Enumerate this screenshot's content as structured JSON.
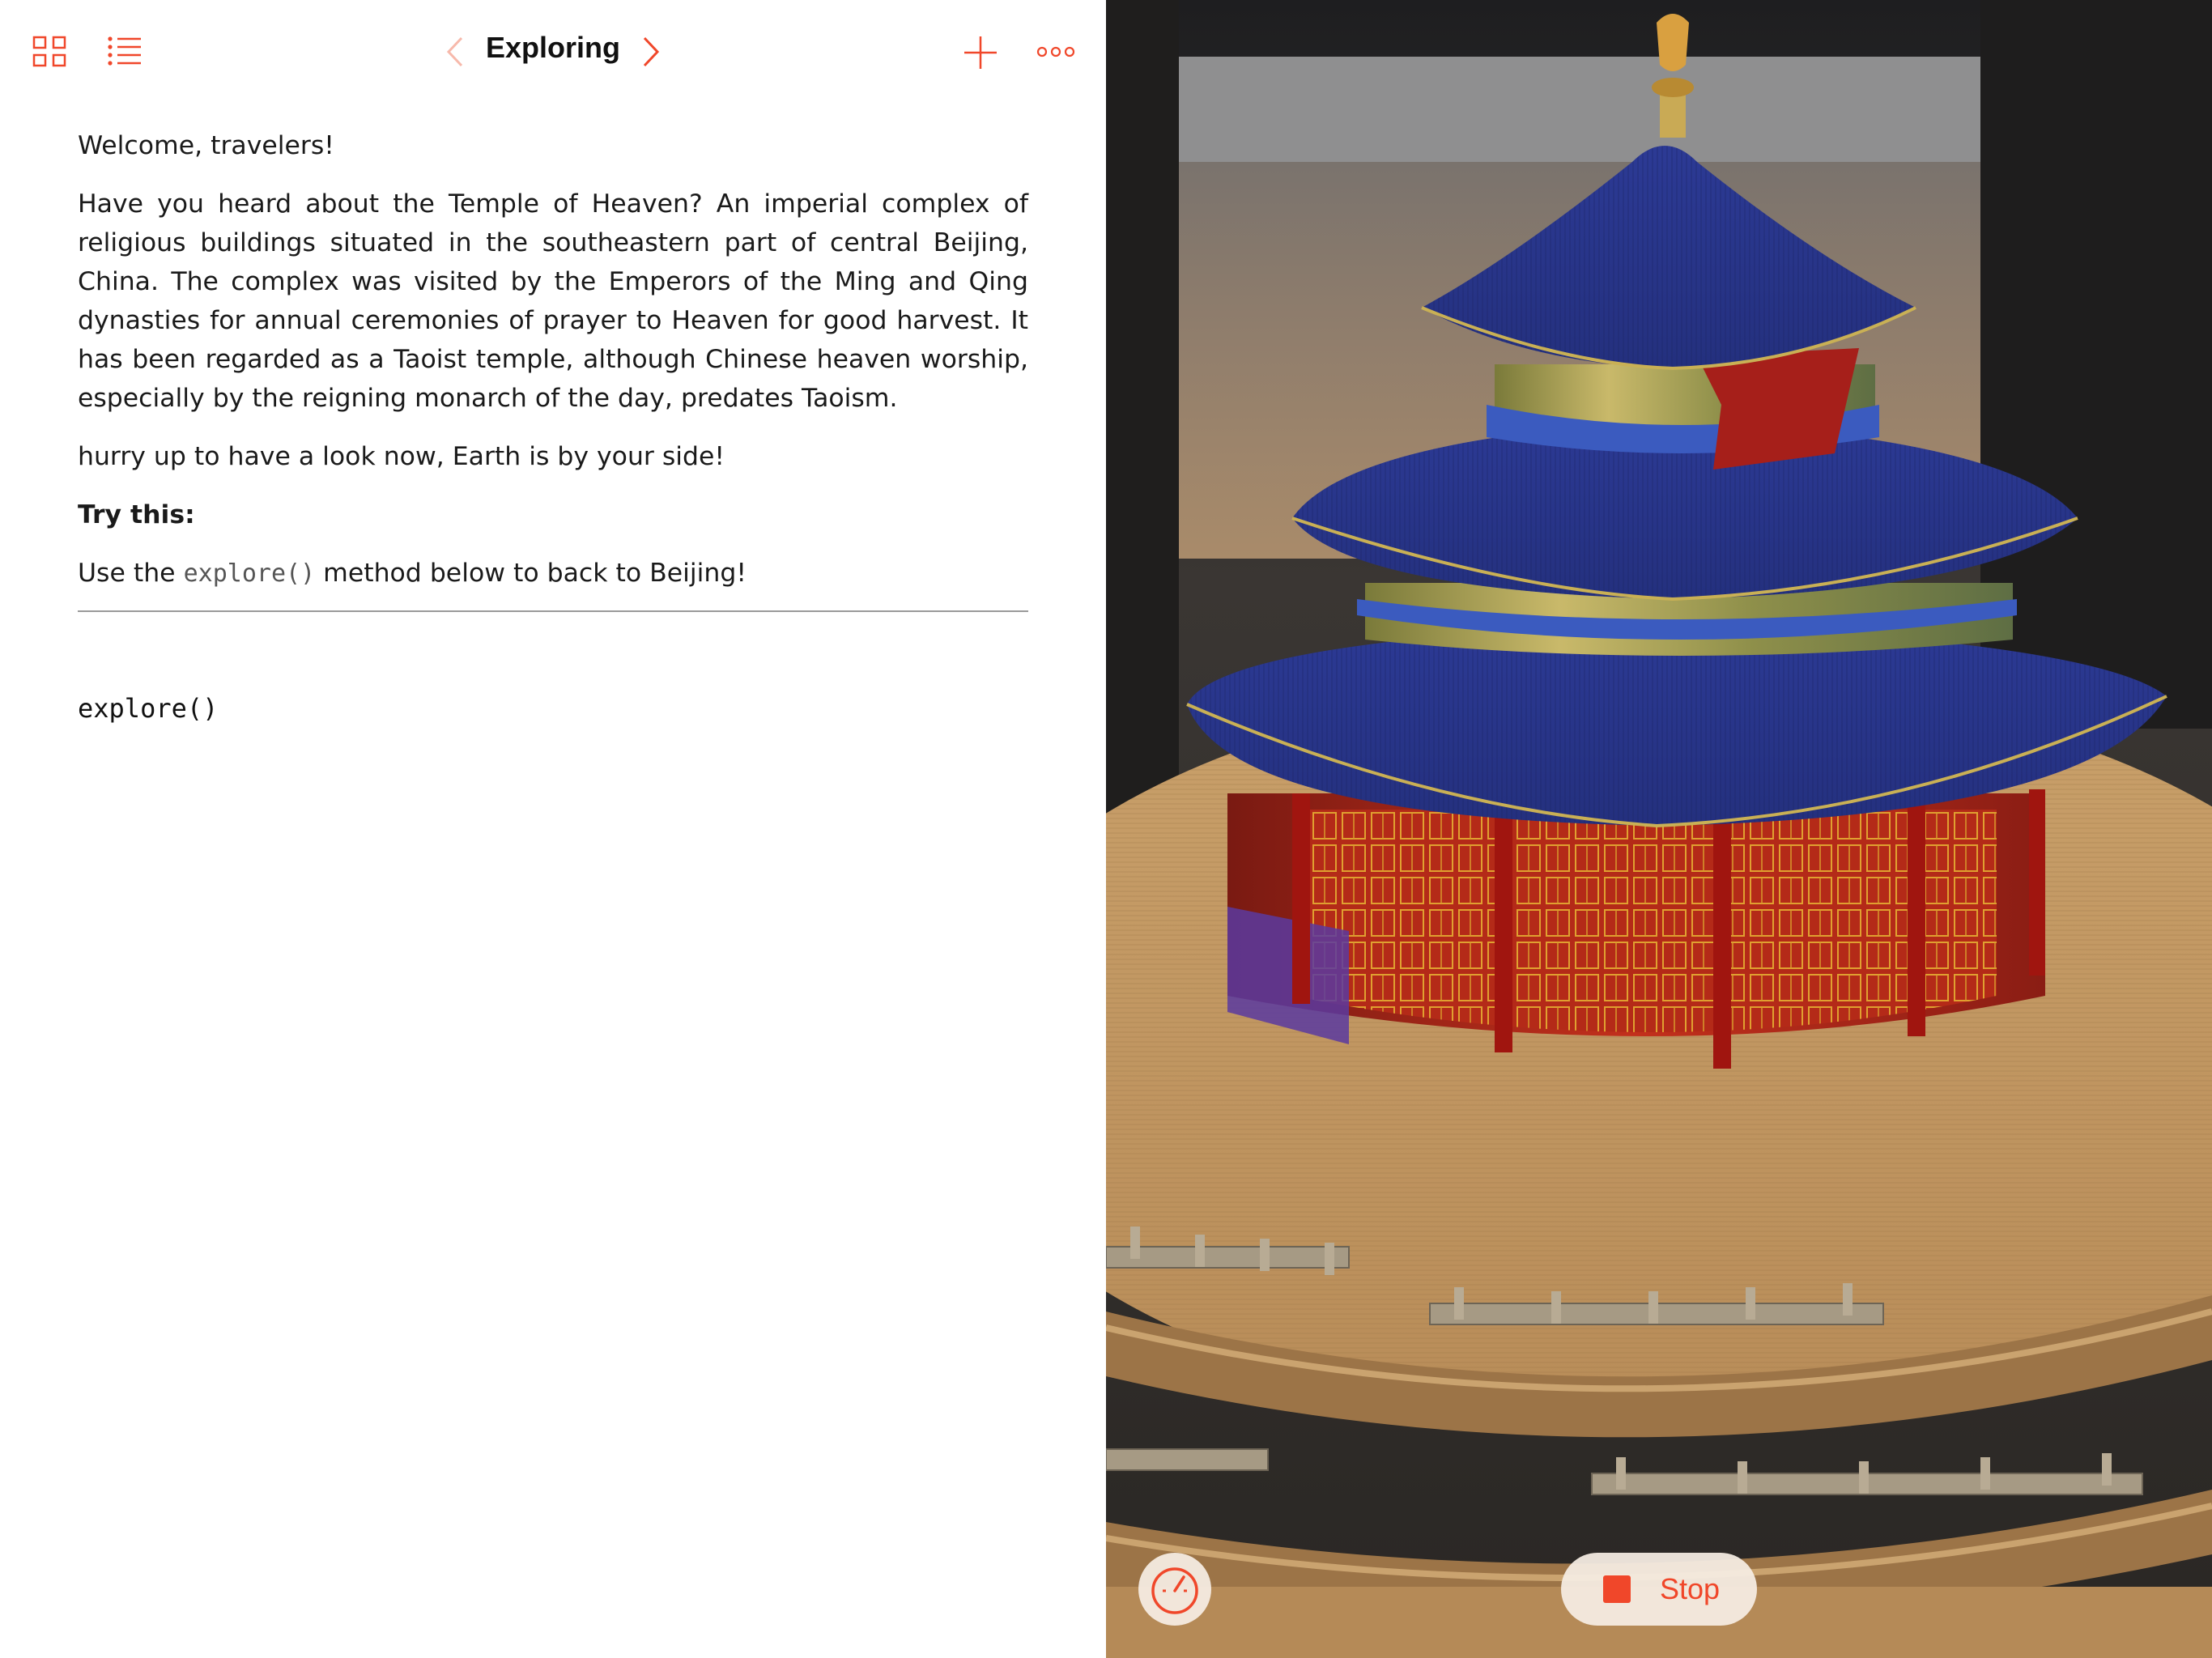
{
  "toolbar": {
    "title": "Exploring",
    "accent_color": "#f0472a",
    "icons": {
      "grid": "grid-icon",
      "list": "list-icon",
      "back": "chevron-left-icon",
      "forward": "chevron-right-icon",
      "add": "plus-icon",
      "more": "more-icon"
    }
  },
  "content": {
    "welcome": "Welcome, travelers!",
    "description": "Have you heard about the Temple of Heaven? An imperial complex of religious buildings situated in the southeastern part of central Beijing, China. The complex was visited by the Emperors of the Ming and Qing dynasties for annual ceremonies of prayer to Heaven for good harvest. It has been regarded as a Taoist temple, although Chinese heaven worship, especially by the reigning monarch of the day, predates Taoism.",
    "hurry": "hurry up to have a look now, Earth is by your side!",
    "try_heading": "Try this:",
    "instruction_prefix": "Use the ",
    "instruction_code": "explore()",
    "instruction_suffix": " method below to back to Beijing!"
  },
  "code": {
    "line1": "explore()"
  },
  "live_view": {
    "stop_label": "Stop",
    "stop_icon": "stop-icon",
    "speed_icon": "speedometer-icon"
  }
}
